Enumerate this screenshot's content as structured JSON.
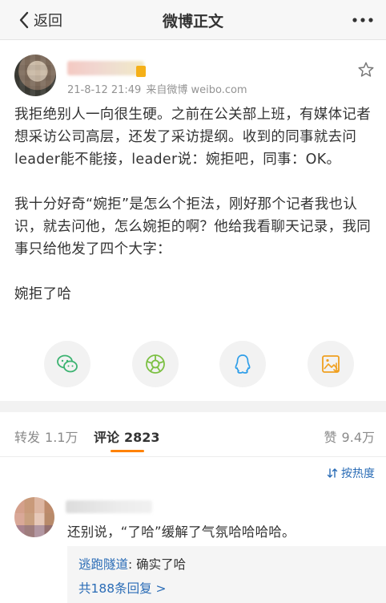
{
  "nav": {
    "back_label": "返回",
    "title": "微博正文"
  },
  "post": {
    "time": "21-8-12 21:49",
    "source": "来自微博 weibo.com",
    "paragraphs": [
      "我拒绝别人一向很生硬。之前在公关部上班，有媒体记者想采访公司高层，还发了采访提纲。收到的同事就去问leader能不能接，leader说：婉拒吧，同事：OK。",
      "我十分好奇“婉拒”是怎么个拒法，刚好那个记者我也认识，就去问他，怎么婉拒的啊？他给我看聊天记录，我同事只给他发了四个大字：",
      "婉拒了哈"
    ]
  },
  "share": {
    "icons": [
      "wechat-icon",
      "moments-icon",
      "qq-icon",
      "save-image-icon"
    ],
    "colors": {
      "icon_green": "#3cb371",
      "icon_blue": "#2f9ee8",
      "icon_orange": "#f0a020"
    }
  },
  "tabs": {
    "repost": {
      "label": "转发",
      "count": "1.1万"
    },
    "comment": {
      "label": "评论",
      "count": "2823"
    },
    "like": {
      "label": "赞",
      "count": "9.4万"
    }
  },
  "sort": {
    "label": "按热度"
  },
  "comment": {
    "text": "还别说，“了哈”缓解了气氛哈哈哈哈。",
    "reply": {
      "user": "逃跑隧道",
      "separator": ": ",
      "text": "确实了哈"
    },
    "more_replies": "共188条回复 >"
  },
  "colors": {
    "accent": "#ff8200",
    "link": "#2a6cb6"
  }
}
